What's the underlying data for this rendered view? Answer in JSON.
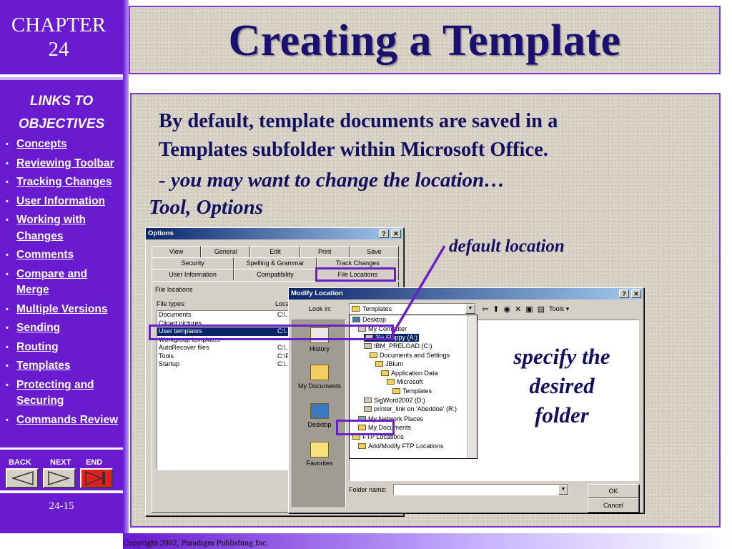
{
  "sidebar": {
    "chapter_line1": "CHAPTER",
    "chapter_line2": "24",
    "links_heading_line1": "LINKS TO",
    "links_heading_line2": "OBJECTIVES",
    "links": [
      {
        "label": "Concepts"
      },
      {
        "label": "Reviewing Toolbar"
      },
      {
        "label": "Tracking Changes"
      },
      {
        "label": "User Information"
      },
      {
        "label": "Working with Changes"
      },
      {
        "label": "Comments"
      },
      {
        "label": "Compare and Merge"
      },
      {
        "label": "Multiple Versions"
      },
      {
        "label": "Sending"
      },
      {
        "label": "Routing"
      },
      {
        "label": "Templates"
      },
      {
        "label": "Protecting and Securing"
      },
      {
        "label": "Commands Review"
      }
    ],
    "nav": {
      "back": "BACK",
      "next": "NEXT",
      "end": "END"
    },
    "slide_number": "24-15"
  },
  "title": "Creating a Template",
  "body": {
    "line1": "By default, template documents are saved in a",
    "line2": "Templates subfolder within Microsoft Office.",
    "line3": "- you may want to change the location…",
    "line4": "Tool, Options"
  },
  "callouts": {
    "default_location": "default location",
    "specify_line1": "specify the",
    "specify_line2": "desired",
    "specify_line3": "folder"
  },
  "options_dialog": {
    "title": "Options",
    "help_btn": "?",
    "close_btn": "✕",
    "tabs_row1": [
      "View",
      "General",
      "Edit",
      "Print",
      "Save"
    ],
    "tabs_row2": [
      "Security",
      "Spelling & Grammar",
      "Track Changes"
    ],
    "tabs_row3": [
      "User Information",
      "Compatibility",
      "File Locations"
    ],
    "file_locations_label": "File locations",
    "file_types_header": "File types:",
    "location_header": "Locatio",
    "rows": [
      {
        "type": "Documents",
        "loc": "C:\\.."
      },
      {
        "type": "Clipart pictures",
        "loc": ""
      },
      {
        "type": "User templates",
        "loc": "C:\\.."
      },
      {
        "type": "Workgroup templates",
        "loc": ""
      },
      {
        "type": "AutoRecover files",
        "loc": "C:\\.."
      },
      {
        "type": "Tools",
        "loc": "C:\\P"
      },
      {
        "type": "Startup",
        "loc": "C:\\.."
      }
    ]
  },
  "modify_dialog": {
    "title": "Modify Location",
    "help_btn": "?",
    "close_btn": "✕",
    "look_in_label": "Look in:",
    "look_in_value": "Templates",
    "tools_label": "Tools ▾",
    "places": [
      "History",
      "My Documents",
      "Desktop",
      "Favorites"
    ],
    "tree": [
      {
        "label": "Desktop",
        "indent": 0
      },
      {
        "label": "My Computer",
        "indent": 1
      },
      {
        "label": "3½ Floppy (A:)",
        "indent": 2
      },
      {
        "label": "IBM_PRELOAD (C:)",
        "indent": 2
      },
      {
        "label": "Documents and Settings",
        "indent": 3
      },
      {
        "label": "JBlum",
        "indent": 4
      },
      {
        "label": "Application Data",
        "indent": 5
      },
      {
        "label": "Microsoft",
        "indent": 6
      },
      {
        "label": "Templates",
        "indent": 7
      },
      {
        "label": "SigWord2002 (D:)",
        "indent": 2
      },
      {
        "label": "printer_link on 'Abeddoe' (R:)",
        "indent": 2
      },
      {
        "label": "My Network Places",
        "indent": 1
      },
      {
        "label": "My Documents",
        "indent": 1
      },
      {
        "label": "FTP Locations",
        "indent": 0
      },
      {
        "label": "Add/Modify FTP Locations",
        "indent": 1
      }
    ],
    "folder_name_label": "Folder name:",
    "ok_label": "OK",
    "cancel_label": "Cancel"
  },
  "copyright": "Copyright 2002, Paradigm Publishing Inc.",
  "colors": {
    "sidebar": "#6a1bd0",
    "title_text": "#1a1070",
    "highlight": "#6c1ec8"
  }
}
